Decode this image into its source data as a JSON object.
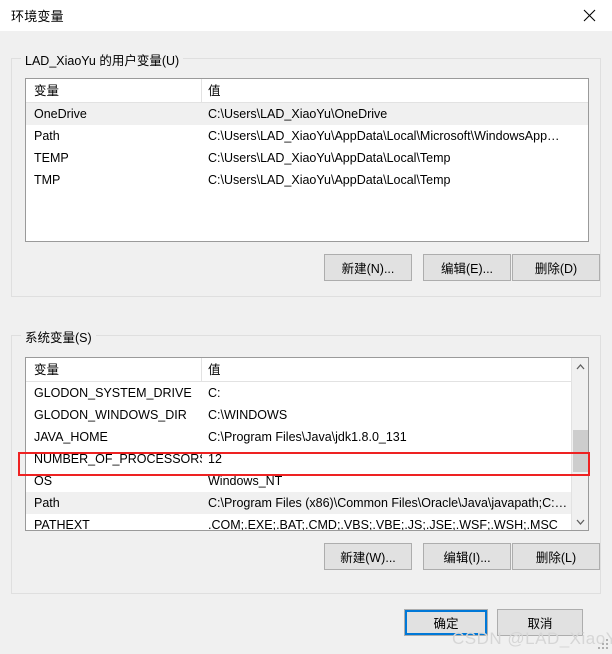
{
  "window": {
    "title": "环境变量",
    "close_icon": "close-icon"
  },
  "user_section": {
    "legend": "LAD_XiaoYu 的用户变量(U)",
    "columns": {
      "name": "变量",
      "value": "值"
    },
    "rows": [
      {
        "name": "OneDrive",
        "value": "C:\\Users\\LAD_XiaoYu\\OneDrive",
        "selected": true
      },
      {
        "name": "Path",
        "value": "C:\\Users\\LAD_XiaoYu\\AppData\\Local\\Microsoft\\WindowsApp…",
        "selected": false
      },
      {
        "name": "TEMP",
        "value": "C:\\Users\\LAD_XiaoYu\\AppData\\Local\\Temp",
        "selected": false
      },
      {
        "name": "TMP",
        "value": "C:\\Users\\LAD_XiaoYu\\AppData\\Local\\Temp",
        "selected": false
      }
    ],
    "buttons": {
      "new": "新建(N)...",
      "edit": "编辑(E)...",
      "delete": "删除(D)"
    }
  },
  "system_section": {
    "legend": "系统变量(S)",
    "columns": {
      "name": "变量",
      "value": "值"
    },
    "rows": [
      {
        "name": "GLODON_SYSTEM_DRIVE",
        "value": "C:",
        "highlighted": false
      },
      {
        "name": "GLODON_WINDOWS_DIR",
        "value": "C:\\WINDOWS",
        "highlighted": false
      },
      {
        "name": "JAVA_HOME",
        "value": "C:\\Program Files\\Java\\jdk1.8.0_131",
        "highlighted": false
      },
      {
        "name": "NUMBER_OF_PROCESSORS",
        "value": "12",
        "highlighted": false
      },
      {
        "name": "OS",
        "value": "Windows_NT",
        "highlighted": false
      },
      {
        "name": "Path",
        "value": "C:\\Program Files (x86)\\Common Files\\Oracle\\Java\\javapath;C:…",
        "highlighted": true
      },
      {
        "name": "PATHEXT",
        "value": ".COM;.EXE;.BAT;.CMD;.VBS;.VBE;.JS;.JSE;.WSF;.WSH;.MSC",
        "highlighted": false
      }
    ],
    "buttons": {
      "new": "新建(W)...",
      "edit": "编辑(I)...",
      "delete": "删除(L)"
    },
    "scrollbar": {
      "up_icon": "chevron-up-icon",
      "down_icon": "chevron-down-icon"
    }
  },
  "footer": {
    "ok": "确定",
    "cancel": "取消"
  },
  "watermark": "CSDN @LAD_XiaoYu",
  "colors": {
    "accent": "#0078d7",
    "annotation": "#ee2222",
    "dialog_bg": "#f0f0f0",
    "list_bg": "#ffffff"
  }
}
